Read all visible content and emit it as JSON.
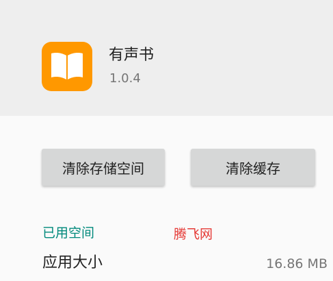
{
  "app": {
    "name": "有声书",
    "version": "1.0.4",
    "icon": "open-book-icon",
    "icon_color": "#ff9800"
  },
  "actions": {
    "clear_storage_label": "清除存储空间",
    "clear_cache_label": "清除缓存"
  },
  "storage": {
    "section_title": "已用空间",
    "watermark": "腾飞网",
    "rows": [
      {
        "label": "应用大小",
        "value": "16.86 MB"
      }
    ]
  },
  "colors": {
    "accent": "#00897b",
    "watermark": "#e53935",
    "button_bg": "#d6d7d7"
  }
}
